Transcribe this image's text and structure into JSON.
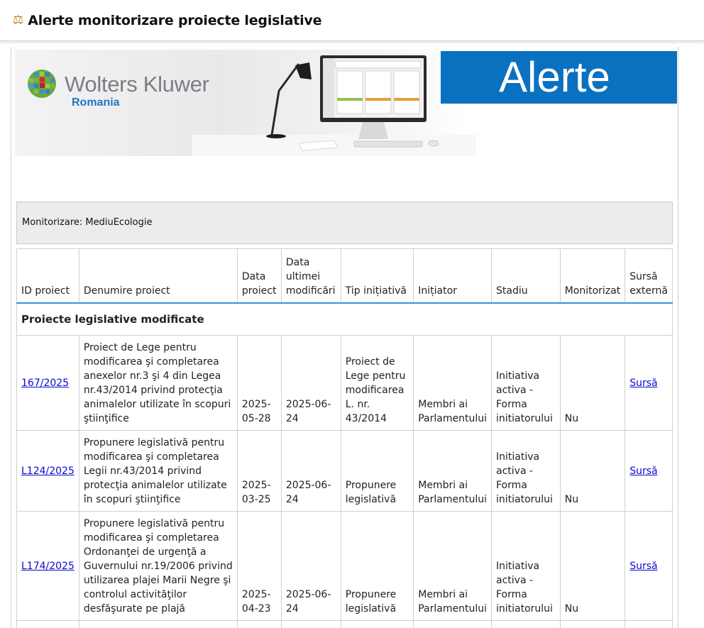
{
  "window": {
    "title": "Alerte monitorizare proiecte legislative",
    "icon": "scales-icon"
  },
  "banner": {
    "brand": "Wolters Kluwer",
    "region": "Romania",
    "product": "Alerte"
  },
  "monitor": {
    "label": "Monitorizare: MediuEcologie"
  },
  "table": {
    "headers": [
      "ID proiect",
      "Denumire proiect",
      "Data proiect",
      "Data ultimei modificări",
      "Tip inițiativă",
      "Inițiator",
      "Stadiu",
      "Monitorizat",
      "Sursă externă"
    ],
    "section_title": "Proiecte legislative modificate",
    "rows": [
      {
        "id": "167/2025",
        "name": "Proiect de Lege pentru modificarea şi completarea anexelor nr.3 şi 4 din Legea nr.43/2014 privind protecţia animalelor utilizate în scopuri ştiinţifice",
        "date": "2025-05-28",
        "modified": "2025-06-24",
        "type": "Proiect de Lege pentru modificarea L. nr. 43/2014",
        "initiator": "Membri ai Parlamentului",
        "stage": "Initiativa activa - Forma initiatorului",
        "monitored": "Nu",
        "source": "Sursă"
      },
      {
        "id": "L124/2025",
        "name": "Propunere legislativă pentru modificarea şi completarea Legii nr.43/2014 privind protecţia animalelor utilizate în scopuri ştiinţifice",
        "date": "2025-03-25",
        "modified": "2025-06-24",
        "type": "Propunere legislativă",
        "initiator": "Membri ai Parlamentului",
        "stage": "Initiativa activa - Forma initiatorului",
        "monitored": "Nu",
        "source": "Sursă"
      },
      {
        "id": "L174/2025",
        "name": "Propunere legislativă pentru modificarea şi completarea Ordonanţei de urgenţă a Guvernului nr.19/2006 privind utilizarea plajei Marii Negre şi controlul activităţilor desfăşurate pe plajă",
        "date": "2025-04-23",
        "modified": "2025-06-24",
        "type": "Propunere legislativă",
        "initiator": "Membri ai Parlamentului",
        "stage": "Initiativa activa - Forma initiatorului",
        "monitored": "Nu",
        "source": "Sursă"
      }
    ]
  },
  "colors": {
    "brand_blue": "#0a71c0",
    "link": "#0a0ad0",
    "header_rule": "#3a8fd6"
  }
}
